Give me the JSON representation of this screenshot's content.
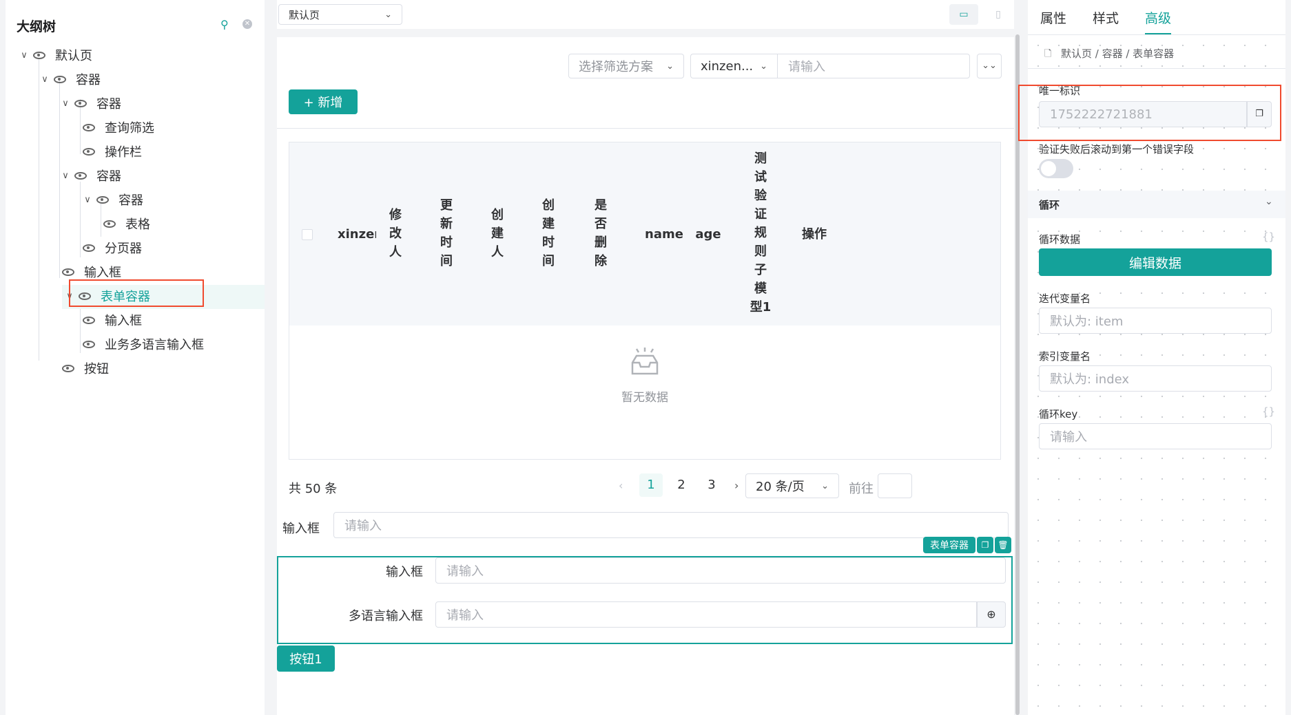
{
  "left_panel": {
    "title": "大纲树",
    "tree": [
      {
        "label": "默认页",
        "expanded": true
      },
      {
        "label": "容器",
        "expanded": true
      },
      {
        "label": "容器",
        "expanded": true
      },
      {
        "label": "查询筛选"
      },
      {
        "label": "操作栏"
      },
      {
        "label": "容器",
        "expanded": true
      },
      {
        "label": "容器",
        "expanded": true
      },
      {
        "label": "表格"
      },
      {
        "label": "分页器"
      },
      {
        "label": "输入框"
      },
      {
        "label": "表单容器",
        "expanded": true,
        "selected": true
      },
      {
        "label": "输入框"
      },
      {
        "label": "业务多语言输入框"
      },
      {
        "label": "按钮"
      }
    ]
  },
  "topbar": {
    "page_select": "默认页"
  },
  "filter": {
    "scheme_placeholder": "选择筛选方案",
    "field_select": "xinzen...",
    "value_placeholder": "请输入"
  },
  "toolbar": {
    "add_label": "+ 新增"
  },
  "table": {
    "columns": [
      "xinzen",
      "修\n改\n人",
      "更\n新\n时\n间",
      "创\n建\n人",
      "创\n建\n时\n间",
      "是\n否\n删\n除",
      "name",
      "age",
      "测\n试\n验\n证\n规\n则\n子\n模\n型1",
      "操作"
    ],
    "empty_text": "暂无数据"
  },
  "pagination": {
    "total": "共 50 条",
    "pages": [
      "1",
      "2",
      "3"
    ],
    "current": "1",
    "page_size": "20 条/页",
    "goto_label": "前往"
  },
  "form": {
    "input1_label": "输入框",
    "input1_placeholder": "请输入",
    "container_tag": "表单容器",
    "input2_label": "输入框",
    "input2_placeholder": "请输入",
    "multilang_label": "多语言输入框",
    "multilang_placeholder": "请输入",
    "button_label": "按钮1"
  },
  "right_panel": {
    "tabs": [
      "属性",
      "样式",
      "高级"
    ],
    "active_tab": "高级",
    "breadcrumb": "默认页 / 容器 / 表单容器",
    "unique_id_label": "唯一标识",
    "unique_id_value": "1752222721881",
    "scroll_error_label": "验证失败后滚动到第一个错误字段",
    "loop_section": "循环",
    "loop_data_label": "循环数据",
    "loop_data_hint": "{}",
    "edit_data_button": "编辑数据",
    "iter_var_label": "迭代变量名",
    "iter_var_placeholder": "默认为: item",
    "index_var_label": "索引变量名",
    "index_var_placeholder": "默认为: index",
    "loop_key_label": "循环key",
    "loop_key_hint": "{}",
    "loop_key_placeholder": "请输入"
  },
  "colors": {
    "accent": "#14a29a",
    "highlight": "#f04a2e"
  }
}
